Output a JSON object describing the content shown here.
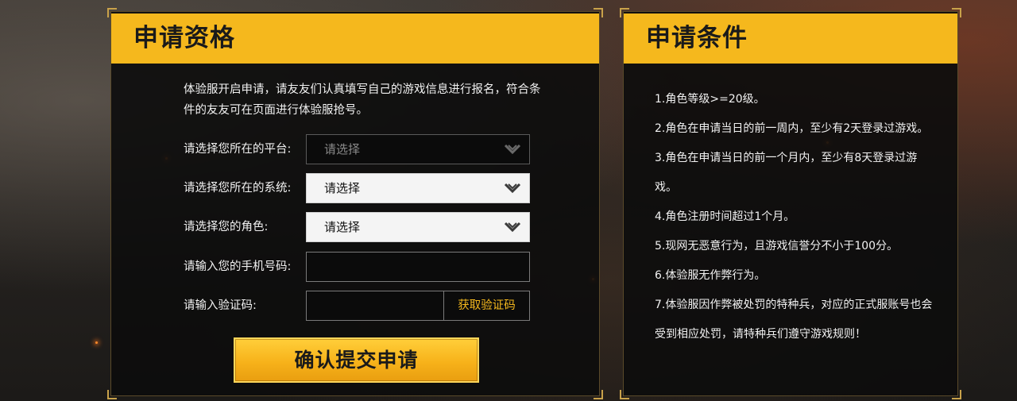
{
  "left_panel": {
    "title": "申请资格",
    "intro": "体验服开启申请，请友友们认真填写自己的游戏信息进行报名，符合条件的友友可在页面进行体验服抢号。",
    "form": {
      "platform_label": "请选择您所在的平台:",
      "platform_value": "请选择",
      "system_label": "请选择您所在的系统:",
      "system_value": "请选择",
      "role_label": "请选择您的角色:",
      "role_value": "请选择",
      "phone_label": "请输入您的手机号码:",
      "phone_value": "",
      "code_label": "请输入验证码:",
      "code_value": "",
      "code_button": "获取验证码"
    },
    "submit_label": "确认提交申请"
  },
  "right_panel": {
    "title": "申请条件",
    "conditions": [
      "1.角色等级>=20级。",
      "2.角色在申请当日的前一周内，至少有2天登录过游戏。",
      "3.角色在申请当日的前一个月内，至少有8天登录过游戏。",
      "4.角色注册时间超过1个月。",
      "5.现网无恶意行为，且游戏信誉分不小于100分。",
      "6.体验服无作弊行为。",
      "7.体验服因作弊被处罚的特种兵，对应的正式服账号也会受到相应处罚，请特种兵们遵守游戏规则！"
    ]
  },
  "colors": {
    "accent": "#f5b81d",
    "panel_bg": "#0c0c0c",
    "text": "#f2f2f2"
  },
  "icons": {
    "select_arrow": "chevron-down-icon"
  }
}
